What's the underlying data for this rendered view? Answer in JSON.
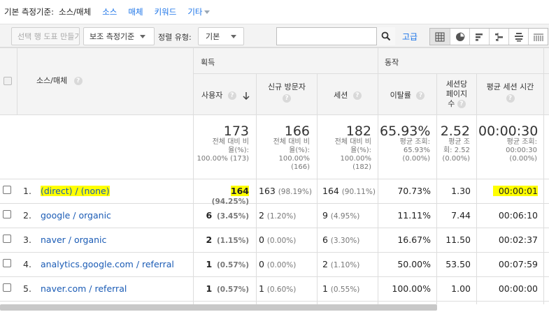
{
  "dimension_bar": {
    "label": "기본 측정기준:",
    "current": "소스/매체",
    "links": [
      "소스",
      "매체",
      "키워드"
    ],
    "more": "기타"
  },
  "toolbar": {
    "create_chart": "선택 행 도표 만들기",
    "secondary_dimension": "보조 측정기준",
    "sort_type_label": "정렬 유형:",
    "sort_type_value": "기본",
    "search_placeholder": "",
    "advanced": "고급",
    "view_icons": [
      "table-view-icon",
      "pie-view-icon",
      "performance-view-icon",
      "comparison-view-icon",
      "term-cloud-view-icon",
      "pivot-view-icon"
    ]
  },
  "table": {
    "dimension_header": "소스/매체",
    "groups": {
      "acquisition": "획득",
      "behavior": "동작"
    },
    "columns": [
      {
        "label": "사용자",
        "sorted": true
      },
      {
        "label": "신규 방문자"
      },
      {
        "label": "세션"
      },
      {
        "label": "이탈률"
      },
      {
        "label1": "세션당",
        "label2": "페이지",
        "label3": "수"
      },
      {
        "label": "평균 세션 시간"
      }
    ],
    "totals": [
      {
        "value": "173",
        "sub1": "전체 대비 비",
        "sub2": "율(%):",
        "sub3": "100.00% (173)"
      },
      {
        "value": "166",
        "sub1": "전체 대비 비",
        "sub2": "율(%):",
        "sub3": "100.00%",
        "sub4": "(166)"
      },
      {
        "value": "182",
        "sub1": "전체 대비 비",
        "sub2": "율(%):",
        "sub3": "100.00%",
        "sub4": "(182)"
      },
      {
        "value": "65.93%",
        "sub1": "평균 조회:",
        "sub2": "65.93%",
        "sub3": "(0.00%)"
      },
      {
        "value": "2.52",
        "sub1": "평균 조",
        "sub2": "회: 2.52",
        "sub3": "(0.00%)"
      },
      {
        "value": "00:00:30",
        "sub1": "평균 조회:",
        "sub2": "00:00:30",
        "sub3": "(0.00%)"
      }
    ],
    "rows": [
      {
        "index": "1.",
        "source": "(direct) / (none)",
        "users": "164",
        "users_pct": "(94.25%)",
        "new_users": "163",
        "new_users_pct": "(98.19%)",
        "sessions": "164",
        "sessions_pct": "(90.11%)",
        "bounce": "70.73%",
        "pages": "1.30",
        "duration": "00:00:01",
        "highlight": true
      },
      {
        "index": "2.",
        "source": "google / organic",
        "users": "6",
        "users_pct": "(3.45%)",
        "new_users": "2",
        "new_users_pct": "(1.20%)",
        "sessions": "9",
        "sessions_pct": "(4.95%)",
        "bounce": "11.11%",
        "pages": "7.44",
        "duration": "00:06:10"
      },
      {
        "index": "3.",
        "source": "naver / organic",
        "users": "2",
        "users_pct": "(1.15%)",
        "new_users": "0",
        "new_users_pct": "(0.00%)",
        "sessions": "6",
        "sessions_pct": "(3.30%)",
        "bounce": "16.67%",
        "pages": "11.50",
        "duration": "00:02:37"
      },
      {
        "index": "4.",
        "source": "analytics.google.com / referral",
        "users": "1",
        "users_pct": "(0.57%)",
        "new_users": "0",
        "new_users_pct": "(0.00%)",
        "sessions": "2",
        "sessions_pct": "(1.10%)",
        "bounce": "50.00%",
        "pages": "53.50",
        "duration": "00:07:59"
      },
      {
        "index": "5.",
        "source": "naver.com / referral",
        "users": "1",
        "users_pct": "(0.57%)",
        "new_users": "1",
        "new_users_pct": "(0.60%)",
        "sessions": "1",
        "sessions_pct": "(0.55%)",
        "bounce": "100.00%",
        "pages": "1.00",
        "duration": "00:00:00"
      }
    ]
  },
  "colors": {
    "link": "#1a73e8",
    "highlight": "#ffff00",
    "header_bg": "#f4f4f4"
  }
}
